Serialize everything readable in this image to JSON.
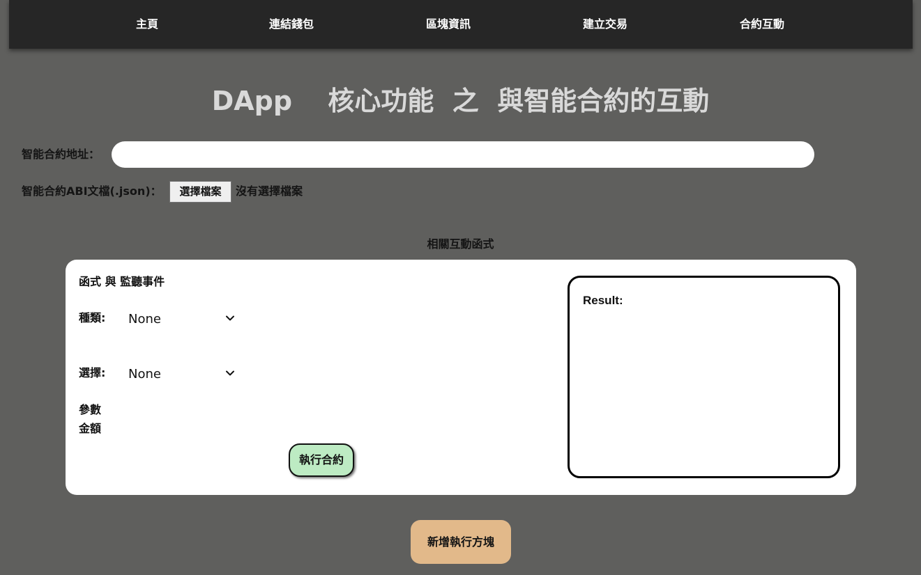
{
  "nav": {
    "items": [
      {
        "label": "主頁"
      },
      {
        "label": "連結錢包"
      },
      {
        "label": "區塊資訊"
      },
      {
        "label": "建立交易"
      },
      {
        "label": "合約互動"
      }
    ]
  },
  "page": {
    "title": "DApp　 核心功能  之  與智能合約的互動"
  },
  "contract_form": {
    "address_label": "智能合約地址：",
    "address_value": "",
    "abi_label": "智能合約ABI文檔(.json)：",
    "file_button_label": "選擇檔案",
    "file_status": "沒有選擇檔案"
  },
  "section": {
    "heading": "相關互動函式"
  },
  "function_card": {
    "title": "函式 與 監聽事件",
    "type_label": "種類:",
    "type_value": "None",
    "choice_label": "選擇:",
    "choice_value": "None",
    "params_label": "參數",
    "amount_label": "金額",
    "execute_label": "執行合約",
    "result_label": "Result:"
  },
  "add_block_label": "新增執行方塊",
  "colors": {
    "background": "#5f5f5d",
    "navbar": "#262626",
    "execute_button": "#bdebc3",
    "add_block_button": "#e2b98a",
    "title_text": "#d9d9d9"
  }
}
